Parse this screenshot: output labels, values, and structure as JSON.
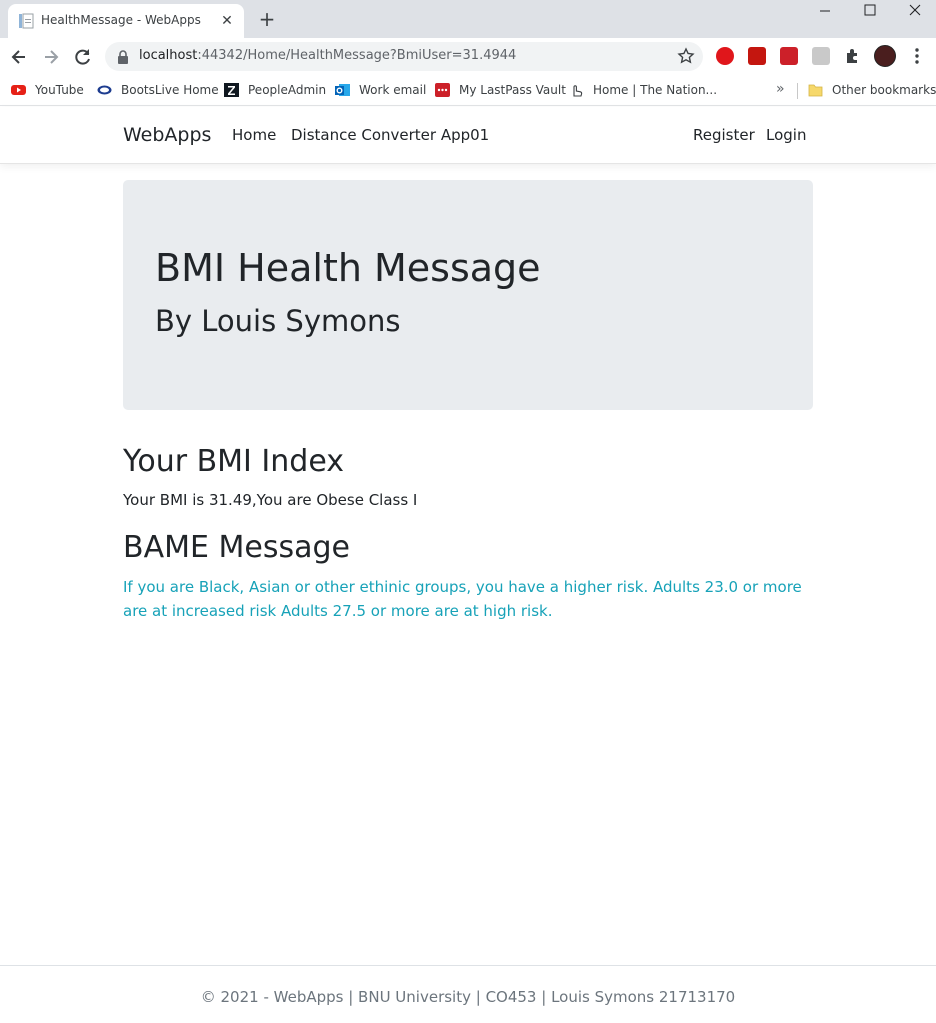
{
  "browser": {
    "tab_title": "HealthMessage - WebApps",
    "url_host": "localhost",
    "url_rest": ":44342/Home/HealthMessage?BmiUser=31.4944",
    "bookmarks": [
      {
        "label": "YouTube",
        "icon": "youtube-icon"
      },
      {
        "label": "BootsLive Home",
        "icon": "boots-icon"
      },
      {
        "label": "PeopleAdmin",
        "icon": "peopleadmin-icon"
      },
      {
        "label": "Work email",
        "icon": "outlook-icon"
      },
      {
        "label": "My LastPass Vault",
        "icon": "lastpass-icon"
      },
      {
        "label": "Home | The Nation...",
        "icon": "hand-pointer-icon"
      }
    ],
    "more_bookmarks": "»",
    "other_bookmarks": "Other bookmarks"
  },
  "nav": {
    "brand": "WebApps",
    "links": [
      "Home",
      "Distance Converter App01"
    ],
    "right_links": [
      "Register",
      "Login"
    ]
  },
  "jumbotron": {
    "title": "BMI Health Message",
    "subtitle": "By Louis Symons"
  },
  "bmi": {
    "heading": "Your BMI Index",
    "text": "Your BMI is 31.49,You are Obese Class I"
  },
  "bame": {
    "heading": "BAME Message",
    "text": "If you are Black, Asian or other ethinic groups, you have a higher risk. Adults 23.0 or more are at increased risk Adults 27.5 or more are at high risk."
  },
  "footer": {
    "text": "© 2021 - WebApps | BNU University | CO453 | Louis Symons 21713170"
  },
  "colors": {
    "jumbotron_bg": "#e9ecef",
    "info_text": "#17a2b8",
    "footer_text": "#6c757d"
  }
}
